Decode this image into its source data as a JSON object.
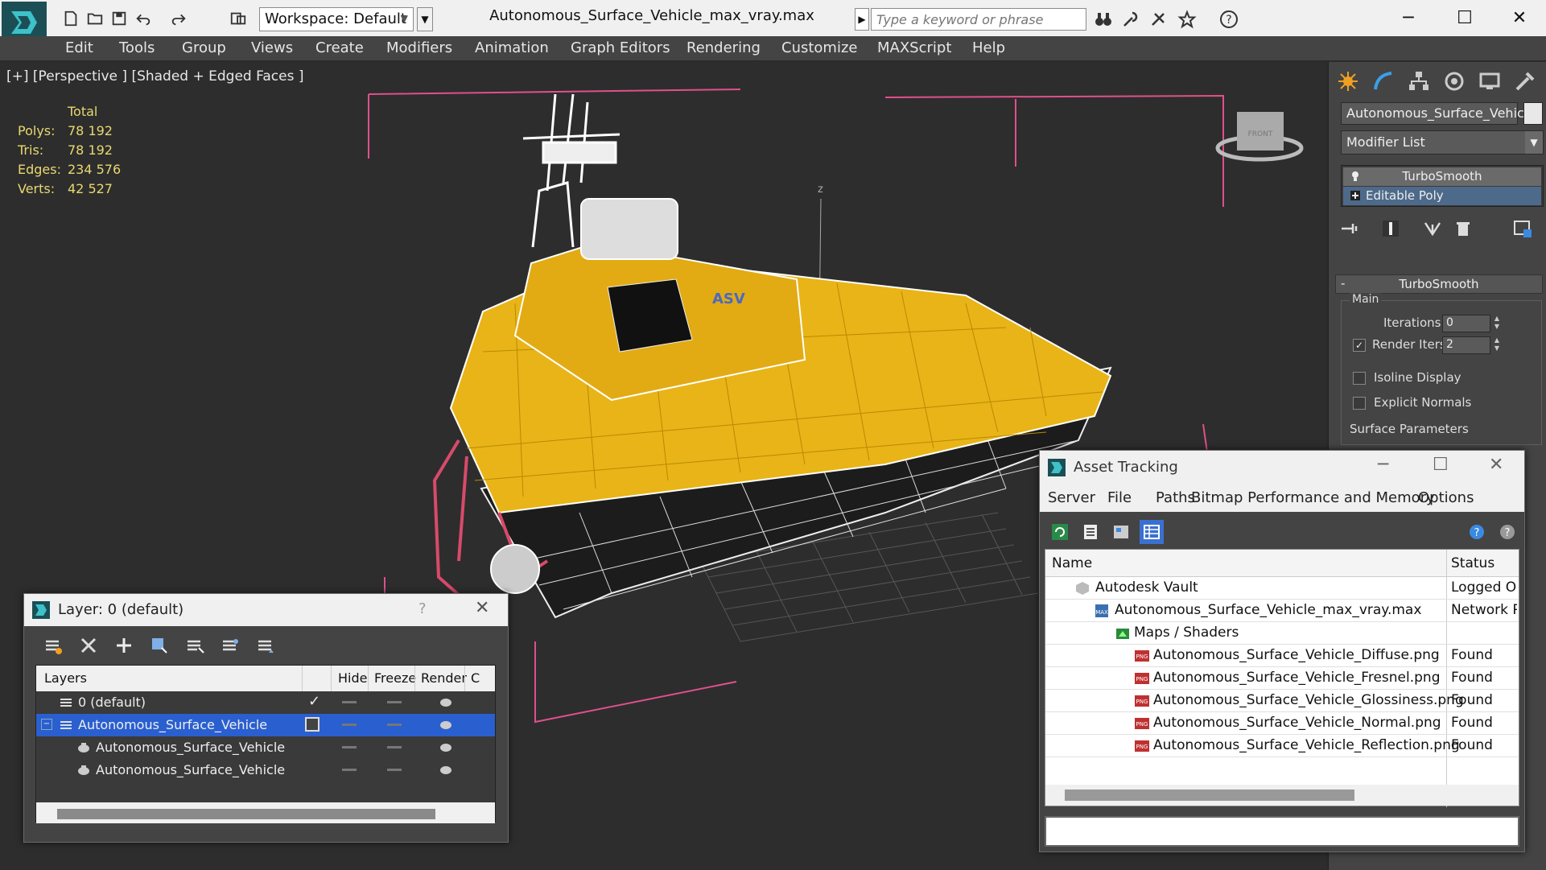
{
  "window": {
    "title": "Autonomous_Surface_Vehicle_max_vray.max",
    "workspace": "Workspace: Default",
    "search_placeholder": "Type a keyword or phrase"
  },
  "menu": [
    "Edit",
    "Tools",
    "Group",
    "Views",
    "Create",
    "Modifiers",
    "Animation",
    "Graph Editors",
    "Rendering",
    "Customize",
    "MAXScript",
    "Help"
  ],
  "viewport": {
    "label": "[+] [Perspective ] [Shaded + Edged Faces ]",
    "stats": {
      "header": "Total",
      "rows": [
        {
          "label": "Polys:",
          "value": "78 192"
        },
        {
          "label": "Tris:",
          "value": "78 192"
        },
        {
          "label": "Edges:",
          "value": "234 576"
        },
        {
          "label": "Verts:",
          "value": "42 527"
        }
      ]
    },
    "axis_label": "z",
    "hull_text": "ASV"
  },
  "command_panel": {
    "object_name": "Autonomous_Surface_Vehicle",
    "modifier_list": "Modifier List",
    "stack": [
      "TurboSmooth",
      "Editable Poly"
    ],
    "rollout_title": "TurboSmooth",
    "group_main": "Main",
    "iterations_label": "Iterations:",
    "iterations_value": "0",
    "render_iters_label": "Render Iters:",
    "render_iters_value": "2",
    "isoline_label": "Isoline Display",
    "explicit_normals_label": "Explicit Normals",
    "surface_params_label": "Surface Parameters"
  },
  "layer_dialog": {
    "title": "Layer: 0 (default)",
    "help": "?",
    "columns": [
      "Layers",
      "Hide",
      "Freeze",
      "Render",
      "C"
    ],
    "rows": [
      {
        "name": "0 (default)",
        "level": 0
      },
      {
        "name": "Autonomous_Surface_Vehicle",
        "level": 0
      },
      {
        "name": "Autonomous_Surface_Vehicle",
        "level": 1
      },
      {
        "name": "Autonomous_Surface_Vehicle",
        "level": 1
      }
    ]
  },
  "asset_dialog": {
    "title": "Asset Tracking",
    "menu": [
      "Server",
      "File",
      "Paths",
      "Bitmap Performance and Memory",
      "Options"
    ],
    "columns": [
      "Name",
      "Status"
    ],
    "rows": [
      {
        "name": "Autodesk Vault",
        "status": "Logged Ou",
        "level": 1,
        "icon": "vault-icon"
      },
      {
        "name": "Autonomous_Surface_Vehicle_max_vray.max",
        "status": "Network P",
        "level": 2,
        "icon": "max-file-icon"
      },
      {
        "name": "Maps / Shaders",
        "status": "",
        "level": 3,
        "icon": "maps-folder-icon"
      },
      {
        "name": "Autonomous_Surface_Vehicle_Diffuse.png",
        "status": "Found",
        "level": 4,
        "icon": "png-icon"
      },
      {
        "name": "Autonomous_Surface_Vehicle_Fresnel.png",
        "status": "Found",
        "level": 4,
        "icon": "png-icon"
      },
      {
        "name": "Autonomous_Surface_Vehicle_Glossiness.png",
        "status": "Found",
        "level": 4,
        "icon": "png-icon"
      },
      {
        "name": "Autonomous_Surface_Vehicle_Normal.png",
        "status": "Found",
        "level": 4,
        "icon": "png-icon"
      },
      {
        "name": "Autonomous_Surface_Vehicle_Reflection.png",
        "status": "Found",
        "level": 4,
        "icon": "png-icon"
      }
    ]
  },
  "colors": {
    "viewport_bg": "#2d2d2d",
    "hull_yellow": "#e8b418",
    "bbox_pink": "#e0508a",
    "stats_yellow": "#e8d870",
    "selection_blue": "#2a5fd0"
  }
}
